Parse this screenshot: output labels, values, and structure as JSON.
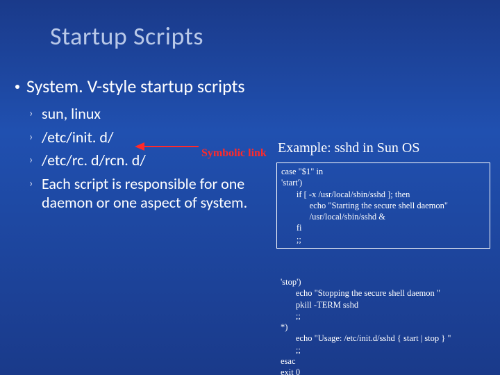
{
  "title": "Startup Scripts",
  "main_bullet": "System. V-style startup scripts",
  "sub": {
    "i0": "sun, linux",
    "i1": "/etc/init. d/",
    "i2": "/etc/rc. d/rcn. d/",
    "i3": "Each script is responsible for one daemon or one aspect of system."
  },
  "symbolic_label": "Symbolic link",
  "example_label": "Example: sshd in Sun OS",
  "code1": "case \"$1\" in\n'start')\n       if [ -x /usr/local/sbin/sshd ]; then\n             echo \"Starting the secure shell daemon\"\n             /usr/local/sbin/sshd &\n       fi\n       ;;",
  "code2": "'stop')\n       echo \"Stopping the secure shell daemon \"\n       pkill -TERM sshd\n       ;;\n*)\n       echo \"Usage: /etc/init.d/sshd { start | stop } \"\n       ;;\nesac\nexit 0"
}
